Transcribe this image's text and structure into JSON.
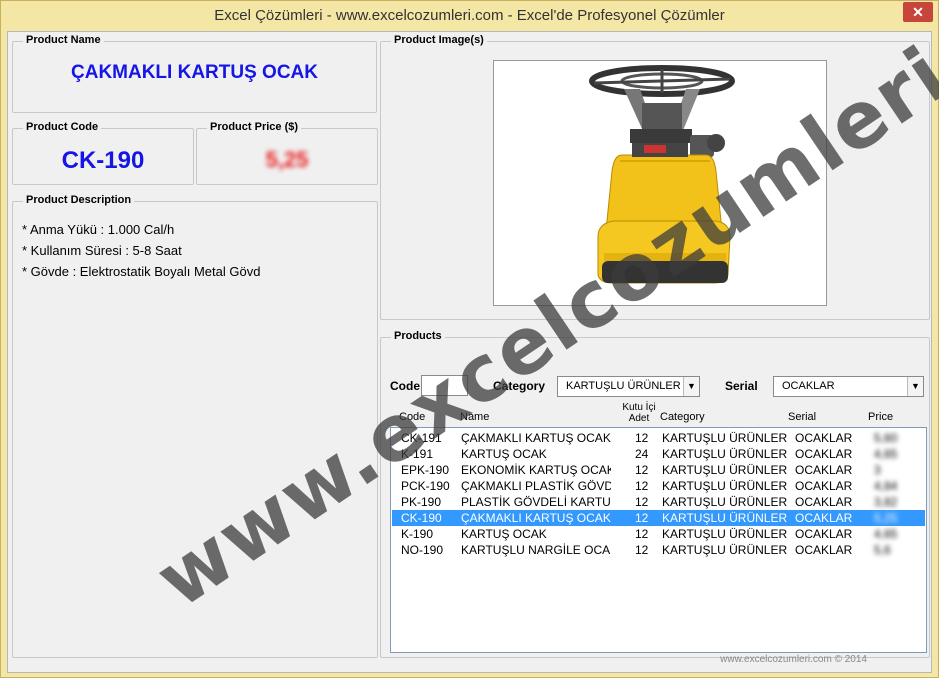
{
  "window": {
    "title": "Excel Çözümleri - www.excelcozumleri.com - Excel'de Profesyonel Çözümler",
    "close_label": "✕"
  },
  "product_name": {
    "title": "Product Name",
    "value": "ÇAKMAKLI KARTUŞ OCAK"
  },
  "product_code": {
    "title": "Product Code",
    "value": "CK-190"
  },
  "product_price": {
    "title": "Product Price ($)",
    "value": "5,25"
  },
  "product_description": {
    "title": "Product Description",
    "lines": [
      "* Anma Yükü : 1.000 Cal/h",
      "* Kullanım Süresi : 5-8 Saat",
      "* Gövde : Elektrostatik Boyalı Metal Gövd"
    ]
  },
  "product_images": {
    "title": "Product Image(s)",
    "image_icon": "gas-stove-image"
  },
  "products": {
    "title": "Products",
    "code_label": "Code",
    "code_value": "",
    "category_label": "Category",
    "category_value": "KARTUŞLU ÜRÜNLER",
    "serial_label": "Serial",
    "serial_value": "OCAKLAR",
    "columns": {
      "code": "Code",
      "name": "Name",
      "qty": "Kutu İçi Adet",
      "category": "Category",
      "serial": "Serial",
      "price": "Price"
    },
    "rows": [
      {
        "code": "CK-191",
        "name": "ÇAKMAKLI KARTUŞ OCAK",
        "qty": "12",
        "category": "KARTUŞLU ÜRÜNLER",
        "serial": "OCAKLAR",
        "price": "5,60"
      },
      {
        "code": "K-191",
        "name": "KARTUŞ OCAK",
        "qty": "24",
        "category": "KARTUŞLU ÜRÜNLER",
        "serial": "OCAKLAR",
        "price": "4,65"
      },
      {
        "code": "EPK-190",
        "name": "EKONOMİK KARTUŞ OCAK",
        "qty": "12",
        "category": "KARTUŞLU ÜRÜNLER",
        "serial": "OCAKLAR",
        "price": "3"
      },
      {
        "code": "PCK-190",
        "name": "ÇAKMAKLI PLASTİK GÖVDELİ",
        "qty": "12",
        "category": "KARTUŞLU ÜRÜNLER",
        "serial": "OCAKLAR",
        "price": "4,84"
      },
      {
        "code": "PK-190",
        "name": "PLASTİK GÖVDELİ KARTUŞ O",
        "qty": "12",
        "category": "KARTUŞLU ÜRÜNLER",
        "serial": "OCAKLAR",
        "price": "3,82"
      },
      {
        "code": "CK-190",
        "name": "ÇAKMAKLI KARTUŞ OCAK",
        "qty": "12",
        "category": "KARTUŞLU ÜRÜNLER",
        "serial": "OCAKLAR",
        "price": "5,25"
      },
      {
        "code": "K-190",
        "name": "KARTUŞ OCAK",
        "qty": "12",
        "category": "KARTUŞLU ÜRÜNLER",
        "serial": "OCAKLAR",
        "price": "4,65"
      },
      {
        "code": "NO-190",
        "name": "KARTUŞLU NARGİLE OCAK",
        "qty": "12",
        "category": "KARTUŞLU ÜRÜNLER",
        "serial": "OCAKLAR",
        "price": "5,6"
      }
    ],
    "selected_index": 5
  },
  "footer": "www.excelcozumleri.com © 2014",
  "watermark": "www.excelcozumleri.com",
  "colors": {
    "accent": "#1515e6",
    "selection": "#3399ff",
    "price_red": "#e82020"
  }
}
